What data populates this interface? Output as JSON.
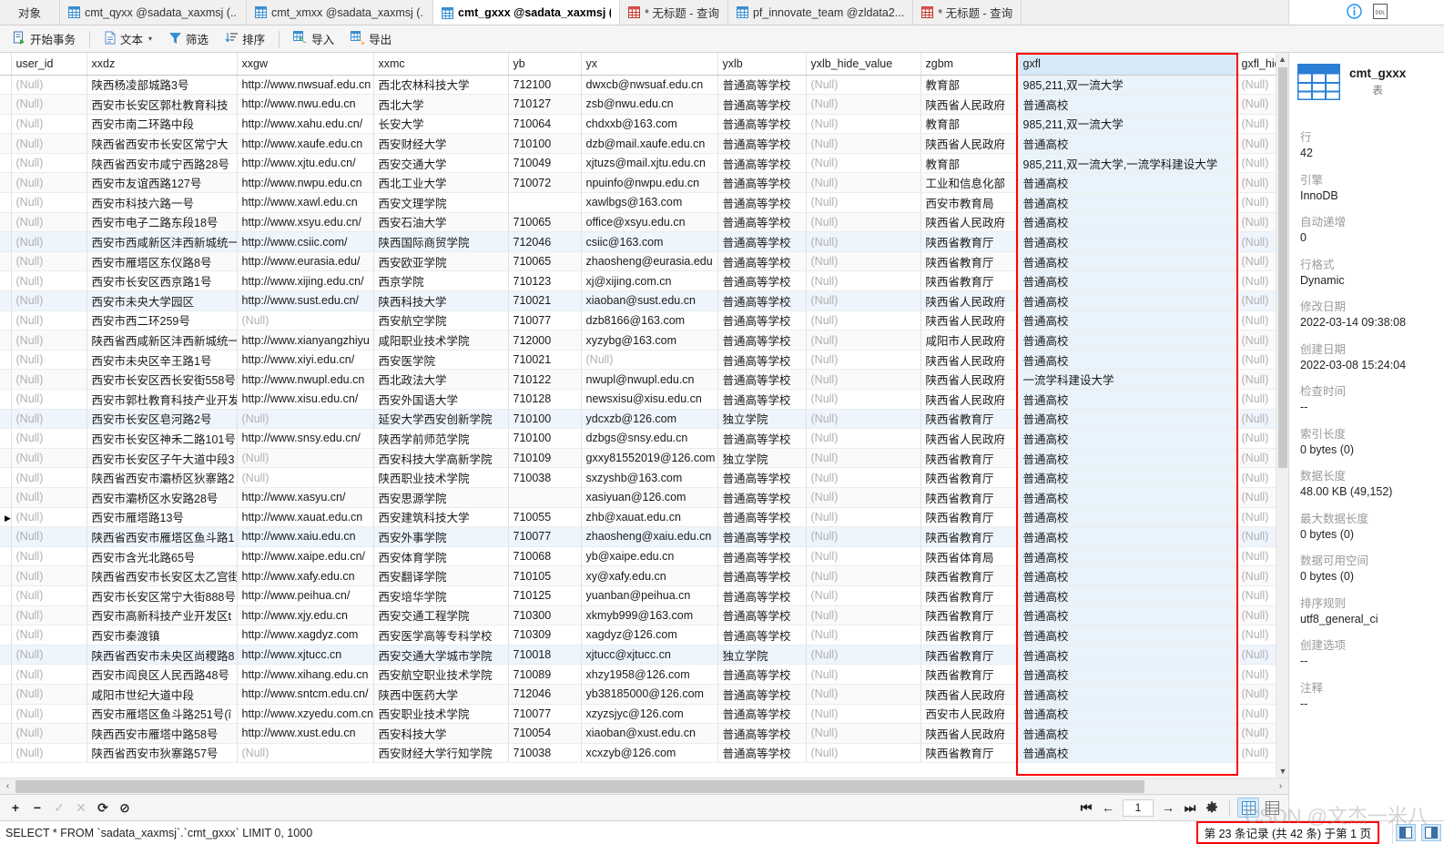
{
  "tabs": [
    {
      "label": "对象",
      "kind": "object",
      "active": false,
      "icon": "none"
    },
    {
      "label": "cmt_qyxx @sadata_xaxmsj (...",
      "kind": "table",
      "active": false,
      "icon": "grid-icon"
    },
    {
      "label": "cmt_xmxx @sadata_xaxmsj (...",
      "kind": "table",
      "active": false,
      "icon": "grid-icon"
    },
    {
      "label": "cmt_gxxx @sadata_xaxmsj (...",
      "kind": "table",
      "active": true,
      "icon": "grid-icon"
    },
    {
      "label": "* 无标题 - 查询",
      "kind": "query",
      "active": false,
      "icon": "query-icon"
    },
    {
      "label": "pf_innovate_team @zldata2...",
      "kind": "table",
      "active": false,
      "icon": "grid-icon"
    },
    {
      "label": "* 无标题 - 查询",
      "kind": "query",
      "active": false,
      "icon": "query-icon"
    }
  ],
  "tabbar_right": {
    "info_icon": "info-icon",
    "ddl_icon": "ddl-icon",
    "ddl_label": "DDL"
  },
  "toolbar": {
    "begin_transaction": "开始事务",
    "text": "文本",
    "filter": "筛选",
    "sort": "排序",
    "import": "导入",
    "export": "导出"
  },
  "grid": {
    "columns": [
      {
        "key": "user_id",
        "label": "user_id",
        "cls": "c-userid",
        "selected": false
      },
      {
        "key": "xxdz",
        "label": "xxdz",
        "cls": "c-xxdz",
        "selected": false
      },
      {
        "key": "xxgw",
        "label": "xxgw",
        "cls": "c-xxgw",
        "selected": false
      },
      {
        "key": "xxmc",
        "label": "xxmc",
        "cls": "c-xxmc",
        "selected": false
      },
      {
        "key": "yb",
        "label": "yb",
        "cls": "c-yb",
        "selected": false
      },
      {
        "key": "yx",
        "label": "yx",
        "cls": "c-yx",
        "selected": false
      },
      {
        "key": "yxlb",
        "label": "yxlb",
        "cls": "c-yxlb",
        "selected": false
      },
      {
        "key": "yxlb_hide_value",
        "label": "yxlb_hide_value",
        "cls": "c-yxlbh",
        "selected": false
      },
      {
        "key": "zgbm",
        "label": "zgbm",
        "cls": "c-zgbm",
        "selected": false
      },
      {
        "key": "gxfl",
        "label": "gxfl",
        "cls": "c-gxfl",
        "selected": true
      },
      {
        "key": "gxfl_hide_value",
        "label": "gxfl_hide_val",
        "cls": "c-gxflh",
        "selected": false
      }
    ],
    "null_text": "(Null)",
    "marker": "▶",
    "marked_row_index": 23,
    "rows": [
      {
        "user_id": null,
        "xxdz": "陕西杨凌部城路3号",
        "xxgw": "http://www.nwsuaf.edu.cn",
        "xxmc": "西北农林科技大学",
        "yb": "712100",
        "yx": "dwxcb@nwsuaf.edu.cn",
        "yxlb": "普通高等学校",
        "yxlb_hide_value": null,
        "zgbm": "教育部",
        "gxfl": "985,211,双一流大学",
        "gxfl_hide_value": null
      },
      {
        "user_id": null,
        "xxdz": "西安市长安区郭杜教育科技",
        "xxgw": "http://www.nwu.edu.cn",
        "xxmc": "西北大学",
        "yb": "710127",
        "yx": "zsb@nwu.edu.cn",
        "yxlb": "普通高等学校",
        "yxlb_hide_value": null,
        "zgbm": "陕西省人民政府",
        "gxfl": "普通高校",
        "gxfl_hide_value": null
      },
      {
        "user_id": null,
        "xxdz": "西安市南二环路中段",
        "xxgw": "http://www.xahu.edu.cn/",
        "xxmc": "长安大学",
        "yb": "710064",
        "yx": "chdxxb@163.com",
        "yxlb": "普通高等学校",
        "yxlb_hide_value": null,
        "zgbm": "教育部",
        "gxfl": "985,211,双一流大学",
        "gxfl_hide_value": null
      },
      {
        "user_id": null,
        "xxdz": "陕西省西安市长安区常宁大",
        "xxgw": "http://www.xaufe.edu.cn",
        "xxmc": "西安财经大学",
        "yb": "710100",
        "yx": "dzb@mail.xaufe.edu.cn",
        "yxlb": "普通高等学校",
        "yxlb_hide_value": null,
        "zgbm": "陕西省人民政府",
        "gxfl": "普通高校",
        "gxfl_hide_value": null
      },
      {
        "user_id": null,
        "xxdz": "陕西省西安市咸宁西路28号",
        "xxgw": "http://www.xjtu.edu.cn/",
        "xxmc": "西安交通大学",
        "yb": "710049",
        "yx": "xjtuzs@mail.xjtu.edu.cn",
        "yxlb": "普通高等学校",
        "yxlb_hide_value": null,
        "zgbm": "教育部",
        "gxfl": "985,211,双一流大学,一流学科建设大学",
        "gxfl_hide_value": null
      },
      {
        "user_id": null,
        "xxdz": "西安市友谊西路127号",
        "xxgw": "http://www.nwpu.edu.cn",
        "xxmc": "西北工业大学",
        "yb": "710072",
        "yx": "npuinfo@nwpu.edu.cn",
        "yxlb": "普通高等学校",
        "yxlb_hide_value": null,
        "zgbm": "工业和信息化部",
        "gxfl": "普通高校",
        "gxfl_hide_value": null
      },
      {
        "user_id": null,
        "xxdz": "西安市科技六路一号",
        "xxgw": "http://www.xawl.edu.cn",
        "xxmc": "西安文理学院",
        "yb": "",
        "yx": "xawlbgs@163.com",
        "yxlb": "普通高等学校",
        "yxlb_hide_value": null,
        "zgbm": "西安市教育局",
        "gxfl": "普通高校",
        "gxfl_hide_value": null
      },
      {
        "user_id": null,
        "xxdz": "西安市电子二路东段18号",
        "xxgw": "http://www.xsyu.edu.cn/",
        "xxmc": "西安石油大学",
        "yb": "710065",
        "yx": "office@xsyu.edu.cn",
        "yxlb": "普通高等学校",
        "yxlb_hide_value": null,
        "zgbm": "陕西省人民政府",
        "gxfl": "普通高校",
        "gxfl_hide_value": null
      },
      {
        "user_id": null,
        "xxdz": "西安市西咸新区沣西新城统一",
        "xxgw": "http://www.csiic.com/",
        "xxmc": "陕西国际商贸学院",
        "yb": "712046",
        "yx": "csiic@163.com",
        "yxlb": "普通高等学校",
        "yxlb_hide_value": null,
        "zgbm": "陕西省教育厅",
        "gxfl": "普通高校",
        "gxfl_hide_value": null
      },
      {
        "user_id": null,
        "xxdz": "西安市雁塔区东仪路8号",
        "xxgw": "http://www.eurasia.edu/",
        "xxmc": "西安欧亚学院",
        "yb": "710065",
        "yx": "zhaosheng@eurasia.edu",
        "yxlb": "普通高等学校",
        "yxlb_hide_value": null,
        "zgbm": "陕西省教育厅",
        "gxfl": "普通高校",
        "gxfl_hide_value": null
      },
      {
        "user_id": null,
        "xxdz": "西安市长安区西京路1号",
        "xxgw": "http://www.xijing.edu.cn/",
        "xxmc": "西京学院",
        "yb": "710123",
        "yx": "xj@xijing.com.cn",
        "yxlb": "普通高等学校",
        "yxlb_hide_value": null,
        "zgbm": "陕西省教育厅",
        "gxfl": "普通高校",
        "gxfl_hide_value": null
      },
      {
        "user_id": null,
        "xxdz": "西安市未央大学园区",
        "xxgw": "http://www.sust.edu.cn/",
        "xxmc": "陕西科技大学",
        "yb": "710021",
        "yx": "xiaoban@sust.edu.cn",
        "yxlb": "普通高等学校",
        "yxlb_hide_value": null,
        "zgbm": "陕西省人民政府",
        "gxfl": "普通高校",
        "gxfl_hide_value": null
      },
      {
        "user_id": null,
        "xxdz": "西安市西二环259号",
        "xxgw": null,
        "xxmc": "西安航空学院",
        "yb": "710077",
        "yx": "dzb8166@163.com",
        "yxlb": "普通高等学校",
        "yxlb_hide_value": null,
        "zgbm": "陕西省人民政府",
        "gxfl": "普通高校",
        "gxfl_hide_value": null
      },
      {
        "user_id": null,
        "xxdz": "陕西省西咸新区沣西新城统一",
        "xxgw": "http://www.xianyangzhiyu",
        "xxmc": "咸阳职业技术学院",
        "yb": "712000",
        "yx": "xyzybg@163.com",
        "yxlb": "普通高等学校",
        "yxlb_hide_value": null,
        "zgbm": "咸阳市人民政府",
        "gxfl": "普通高校",
        "gxfl_hide_value": null
      },
      {
        "user_id": null,
        "xxdz": "西安市未央区辛王路1号",
        "xxgw": "http://www.xiyi.edu.cn/",
        "xxmc": "西安医学院",
        "yb": "710021",
        "yx": null,
        "yxlb": "普通高等学校",
        "yxlb_hide_value": null,
        "zgbm": "陕西省人民政府",
        "gxfl": "普通高校",
        "gxfl_hide_value": null
      },
      {
        "user_id": null,
        "xxdz": "西安市长安区西长安街558号",
        "xxgw": "http://www.nwupl.edu.cn",
        "xxmc": "西北政法大学",
        "yb": "710122",
        "yx": "nwupl@nwupl.edu.cn",
        "yxlb": "普通高等学校",
        "yxlb_hide_value": null,
        "zgbm": "陕西省人民政府",
        "gxfl": "一流学科建设大学",
        "gxfl_hide_value": null
      },
      {
        "user_id": null,
        "xxdz": "西安市郭杜教育科技产业开发",
        "xxgw": "http://www.xisu.edu.cn/",
        "xxmc": "西安外国语大学",
        "yb": "710128",
        "yx": "newsxisu@xisu.edu.cn",
        "yxlb": "普通高等学校",
        "yxlb_hide_value": null,
        "zgbm": "陕西省人民政府",
        "gxfl": "普通高校",
        "gxfl_hide_value": null
      },
      {
        "user_id": null,
        "xxdz": "西安市长安区皂河路2号",
        "xxgw": null,
        "xxmc": "延安大学西安创新学院",
        "yb": "710100",
        "yx": "ydcxzb@126.com",
        "yxlb": "独立学院",
        "yxlb_hide_value": null,
        "zgbm": "陕西省教育厅",
        "gxfl": "普通高校",
        "gxfl_hide_value": null
      },
      {
        "user_id": null,
        "xxdz": "西安市长安区神禾二路101号",
        "xxgw": "http://www.snsy.edu.cn/",
        "xxmc": "陕西学前师范学院",
        "yb": "710100",
        "yx": "dzbgs@snsy.edu.cn",
        "yxlb": "普通高等学校",
        "yxlb_hide_value": null,
        "zgbm": "陕西省人民政府",
        "gxfl": "普通高校",
        "gxfl_hide_value": null
      },
      {
        "user_id": null,
        "xxdz": "西安市长安区子午大道中段3",
        "xxgw": null,
        "xxmc": "西安科技大学高新学院",
        "yb": "710109",
        "yx": "gxxy81552019@126.com",
        "yxlb": "独立学院",
        "yxlb_hide_value": null,
        "zgbm": "陕西省教育厅",
        "gxfl": "普通高校",
        "gxfl_hide_value": null
      },
      {
        "user_id": null,
        "xxdz": "陕西省西安市灞桥区狄寨路2",
        "xxgw": null,
        "xxmc": "陕西职业技术学院",
        "yb": "710038",
        "yx": "sxzyshb@163.com",
        "yxlb": "普通高等学校",
        "yxlb_hide_value": null,
        "zgbm": "陕西省教育厅",
        "gxfl": "普通高校",
        "gxfl_hide_value": null
      },
      {
        "user_id": null,
        "xxdz": "西安市灞桥区水安路28号",
        "xxgw": "http://www.xasyu.cn/",
        "xxmc": "西安思源学院",
        "yb": "",
        "yx": "xasiyuan@126.com",
        "yxlb": "普通高等学校",
        "yxlb_hide_value": null,
        "zgbm": "陕西省教育厅",
        "gxfl": "普通高校",
        "gxfl_hide_value": null
      },
      {
        "user_id": null,
        "xxdz": "西安市雁塔路13号",
        "xxgw": "http://www.xauat.edu.cn",
        "xxmc": "西安建筑科技大学",
        "yb": "710055",
        "yx": "zhb@xauat.edu.cn",
        "yxlb": "普通高等学校",
        "yxlb_hide_value": null,
        "zgbm": "陕西省教育厅",
        "gxfl": "普通高校",
        "gxfl_hide_value": null
      },
      {
        "user_id": null,
        "xxdz": "陕西省西安市雁塔区鱼斗路1",
        "xxgw": "http://www.xaiu.edu.cn",
        "xxmc": "西安外事学院",
        "yb": "710077",
        "yx": "zhaosheng@xaiu.edu.cn",
        "yxlb": "普通高等学校",
        "yxlb_hide_value": null,
        "zgbm": "陕西省教育厅",
        "gxfl": "普通高校",
        "gxfl_hide_value": null
      },
      {
        "user_id": null,
        "xxdz": "西安市含光北路65号",
        "xxgw": "http://www.xaipe.edu.cn/",
        "xxmc": "西安体育学院",
        "yb": "710068",
        "yx": "yb@xaipe.edu.cn",
        "yxlb": "普通高等学校",
        "yxlb_hide_value": null,
        "zgbm": "陕西省体育局",
        "gxfl": "普通高校",
        "gxfl_hide_value": null
      },
      {
        "user_id": null,
        "xxdz": "陕西省西安市长安区太乙宫街",
        "xxgw": "http://www.xafy.edu.cn",
        "xxmc": "西安翻译学院",
        "yb": "710105",
        "yx": "xy@xafy.edu.cn",
        "yxlb": "普通高等学校",
        "yxlb_hide_value": null,
        "zgbm": "陕西省教育厅",
        "gxfl": "普通高校",
        "gxfl_hide_value": null
      },
      {
        "user_id": null,
        "xxdz": "西安市长安区常宁大街888号",
        "xxgw": "http://www.peihua.cn/",
        "xxmc": "西安培华学院",
        "yb": "710125",
        "yx": "yuanban@peihua.cn",
        "yxlb": "普通高等学校",
        "yxlb_hide_value": null,
        "zgbm": "陕西省教育厅",
        "gxfl": "普通高校",
        "gxfl_hide_value": null
      },
      {
        "user_id": null,
        "xxdz": "西安市高新科技产业开发区t",
        "xxgw": "http://www.xjy.edu.cn",
        "xxmc": "西安交通工程学院",
        "yb": "710300",
        "yx": "xkmyb999@163.com",
        "yxlb": "普通高等学校",
        "yxlb_hide_value": null,
        "zgbm": "陕西省教育厅",
        "gxfl": "普通高校",
        "gxfl_hide_value": null
      },
      {
        "user_id": null,
        "xxdz": "西安市秦渡镇",
        "xxgw": "http://www.xagdyz.com",
        "xxmc": "西安医学高等专科学校",
        "yb": "710309",
        "yx": "xagdyz@126.com",
        "yxlb": "普通高等学校",
        "yxlb_hide_value": null,
        "zgbm": "陕西省教育厅",
        "gxfl": "普通高校",
        "gxfl_hide_value": null
      },
      {
        "user_id": null,
        "xxdz": "陕西省西安市未央区尚稷路8",
        "xxgw": "http://www.xjtucc.cn",
        "xxmc": "西安交通大学城市学院",
        "yb": "710018",
        "yx": "xjtucc@xjtucc.cn",
        "yxlb": "独立学院",
        "yxlb_hide_value": null,
        "zgbm": "陕西省教育厅",
        "gxfl": "普通高校",
        "gxfl_hide_value": null
      },
      {
        "user_id": null,
        "xxdz": "西安市阎良区人民西路48号",
        "xxgw": "http://www.xihang.edu.cn",
        "xxmc": "西安航空职业技术学院",
        "yb": "710089",
        "yx": "xhzy1958@126.com",
        "yxlb": "普通高等学校",
        "yxlb_hide_value": null,
        "zgbm": "陕西省教育厅",
        "gxfl": "普通高校",
        "gxfl_hide_value": null
      },
      {
        "user_id": null,
        "xxdz": "咸阳市世纪大道中段",
        "xxgw": "http://www.sntcm.edu.cn/",
        "xxmc": "陕西中医药大学",
        "yb": "712046",
        "yx": "yb38185000@126.com",
        "yxlb": "普通高等学校",
        "yxlb_hide_value": null,
        "zgbm": "陕西省人民政府",
        "gxfl": "普通高校",
        "gxfl_hide_value": null
      },
      {
        "user_id": null,
        "xxdz": "西安市雁塔区鱼斗路251号(î",
        "xxgw": "http://www.xzyedu.com.cn",
        "xxmc": "西安职业技术学院",
        "yb": "710077",
        "yx": "xzyzsjyc@126.com",
        "yxlb": "普通高等学校",
        "yxlb_hide_value": null,
        "zgbm": "西安市人民政府",
        "gxfl": "普通高校",
        "gxfl_hide_value": null
      },
      {
        "user_id": null,
        "xxdz": "陕西西安市雁塔中路58号",
        "xxgw": "http://www.xust.edu.cn",
        "xxmc": "西安科技大学",
        "yb": "710054",
        "yx": "xiaoban@xust.edu.cn",
        "yxlb": "普通高等学校",
        "yxlb_hide_value": null,
        "zgbm": "陕西省人民政府",
        "gxfl": "普通高校",
        "gxfl_hide_value": null
      },
      {
        "user_id": null,
        "xxdz": "陕西省西安市狄寨路57号",
        "xxgw": null,
        "xxmc": "西安财经大学行知学院",
        "yb": "710038",
        "yx": "xcxzyb@126.com",
        "yxlb": "普通高等学校",
        "yxlb_hide_value": null,
        "zgbm": "陕西省教育厅",
        "gxfl": "普通高校",
        "gxfl_hide_value": null
      }
    ]
  },
  "navbar": {
    "add": "+",
    "remove": "−",
    "confirm": "✓",
    "cancel": "✕",
    "refresh": "⟳",
    "stop": "⊘",
    "first_page": "⏮",
    "prev_page": "←",
    "page_value": "1",
    "next_page": "→",
    "last_page": "⏭",
    "settings": "gear-icon",
    "grid_view": "grid-view-icon",
    "form_view": "form-view-icon"
  },
  "statusbar": {
    "sql": "SELECT * FROM `sadata_xaxmsj`.`cmt_gxxx` LIMIT 0, 1000",
    "record_info": "第 23 条记录 (共 42 条) 于第 1 页",
    "watermark": "CSDN @文杰一米八"
  },
  "info_panel": {
    "title": "cmt_gxxx",
    "subtitle": "表",
    "fields": [
      {
        "key": "行",
        "value": "42"
      },
      {
        "key": "引擎",
        "value": "InnoDB"
      },
      {
        "key": "自动递增",
        "value": "0"
      },
      {
        "key": "行格式",
        "value": "Dynamic"
      },
      {
        "key": "修改日期",
        "value": "2022-03-14 09:38:08"
      },
      {
        "key": "创建日期",
        "value": "2022-03-08 15:24:04"
      },
      {
        "key": "检查时间",
        "value": "--"
      },
      {
        "key": "索引长度",
        "value": "0 bytes (0)"
      },
      {
        "key": "数据长度",
        "value": "48.00 KB (49,152)"
      },
      {
        "key": "最大数据长度",
        "value": "0 bytes (0)"
      },
      {
        "key": "数据可用空间",
        "value": "0 bytes (0)"
      },
      {
        "key": "排序规则",
        "value": "utf8_general_ci"
      },
      {
        "key": "创建选项",
        "value": "--"
      },
      {
        "key": "注释",
        "value": "--"
      }
    ]
  },
  "colors": {
    "accent": "#2a7fd4",
    "selection": "#d6e9f8",
    "highlight_box": "#ff0000",
    "toolbar_bg": "#f5f5f5"
  }
}
